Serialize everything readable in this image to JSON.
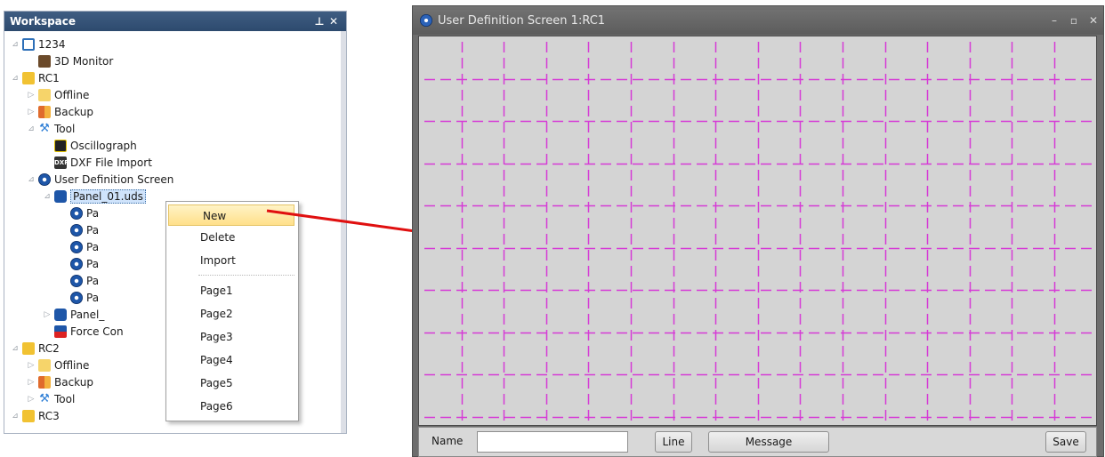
{
  "workspace": {
    "title": "Workspace",
    "pin_glyph": "⊥",
    "close_glyph": "✕",
    "tree": [
      {
        "label": "1234",
        "icon": "computer-icon",
        "expander": "⊿"
      },
      {
        "label": "3D Monitor",
        "icon": "3d-monitor-icon",
        "expander": ""
      },
      {
        "label": "RC1",
        "icon": "robot-controller-icon",
        "expander": "⊿"
      },
      {
        "label": "Offline",
        "icon": "offline-icon",
        "expander": "▷"
      },
      {
        "label": "Backup",
        "icon": "backup-icon",
        "expander": "▷"
      },
      {
        "label": "Tool",
        "icon": "tool-icon",
        "expander": "⊿"
      },
      {
        "label": "Oscillograph",
        "icon": "oscillograph-icon",
        "expander": ""
      },
      {
        "label": "DXF File Import",
        "icon": "dxf-icon",
        "expander": ""
      },
      {
        "label": "User Definition Screen",
        "icon": "user-definition-screen-icon",
        "expander": "⊿"
      },
      {
        "label": "Panel_01.uds",
        "icon": "panel-icon",
        "expander": "⊿"
      },
      {
        "label": "Pa",
        "icon": "page-icon",
        "expander": ""
      },
      {
        "label": "Pa",
        "icon": "page-icon",
        "expander": ""
      },
      {
        "label": "Pa",
        "icon": "page-icon",
        "expander": ""
      },
      {
        "label": "Pa",
        "icon": "page-icon",
        "expander": ""
      },
      {
        "label": "Pa",
        "icon": "page-icon",
        "expander": ""
      },
      {
        "label": "Pa",
        "icon": "page-icon",
        "expander": ""
      },
      {
        "label": "Panel_",
        "icon": "panel-icon",
        "expander": "▷"
      },
      {
        "label": "Force Con",
        "icon": "force-control-icon",
        "expander": ""
      },
      {
        "label": "RC2",
        "icon": "robot-controller-icon",
        "expander": "⊿"
      },
      {
        "label": "Offline",
        "icon": "offline-icon",
        "expander": "▷"
      },
      {
        "label": "Backup",
        "icon": "backup-icon",
        "expander": "▷"
      },
      {
        "label": "Tool",
        "icon": "tool-icon",
        "expander": "▷"
      },
      {
        "label": "RC3",
        "icon": "robot-controller-icon",
        "expander": "⊿"
      }
    ]
  },
  "context_menu": {
    "items": [
      "New",
      "Delete",
      "Import",
      "Page1",
      "Page2",
      "Page3",
      "Page4",
      "Page5",
      "Page6"
    ],
    "highlighted": "New"
  },
  "window": {
    "title": "User Definition Screen 1:RC1",
    "minimize_glyph": "–",
    "maximize_glyph": "▫",
    "close_glyph": "✕",
    "grid_color": "#d63ad6",
    "bottom": {
      "name_label": "Name",
      "name_value": "",
      "line_button": "Line",
      "message_button": "Message",
      "save_button": "Save"
    }
  },
  "arrow_color": "#e01010"
}
